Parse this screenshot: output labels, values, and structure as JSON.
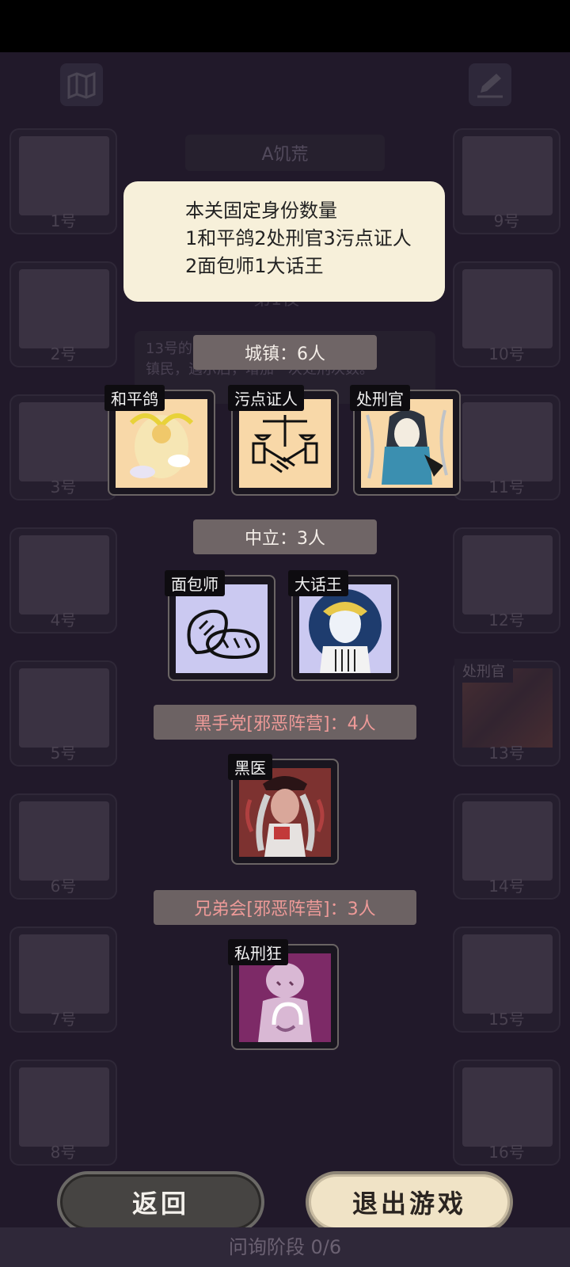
{
  "game_title": "A饥荒",
  "players_left": [
    "1号",
    "2号",
    "3号",
    "4号",
    "5号",
    "6号",
    "7号",
    "8号"
  ],
  "players_right": [
    "9号",
    "10号",
    "11号",
    "12号",
    "13号",
    "14号",
    "15号",
    "16号"
  ],
  "revealed_player": {
    "number": "13号",
    "role": "处刑官"
  },
  "background_panel": {
    "header": "第1夜",
    "line1": "13号的",
    "line2": "镇民，遇示后，增加一次处刑次数。"
  },
  "tooltip": {
    "line1": "本关固定身份数量",
    "line2": "1和平鸽2处刑官3污点证人",
    "line3": "2面包师1大话王"
  },
  "sections": {
    "town": "城镇：6人",
    "neutral": "中立：3人",
    "mafia": "黑手党[邪恶阵营]：4人",
    "brotherhood": "兄弟会[邪恶阵营]：3人"
  },
  "roles": {
    "peace_dove": "和平鸽",
    "tainted_witness": "污点证人",
    "executioner": "处刑官",
    "baker": "面包师",
    "liar_king": "大话王",
    "black_doctor": "黑医",
    "vigilante": "私刑狂"
  },
  "buttons": {
    "back": "返回",
    "exit": "退出游戏"
  },
  "bottom_status": "问询阶段 0/6",
  "colors": {
    "tooltip_bg": "#f7f0da",
    "evil_text": "#ee9a98",
    "peach": "#f8d8a8",
    "lavender": "#cbc9f1"
  }
}
